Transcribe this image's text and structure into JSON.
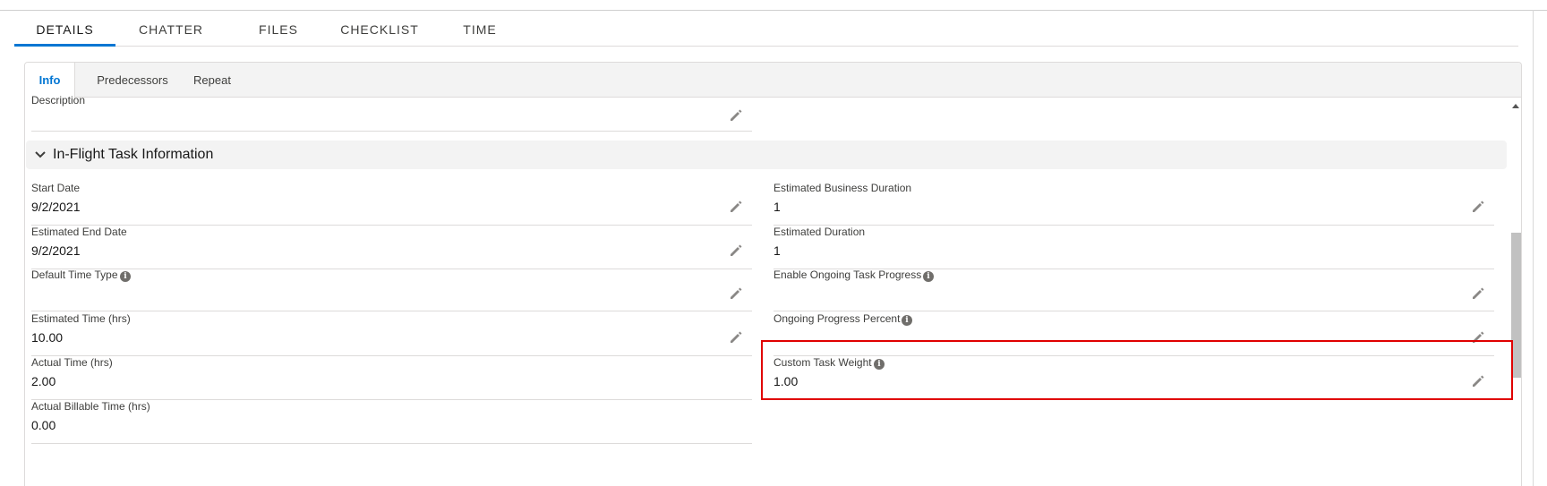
{
  "main_tabs": [
    "DETAILS",
    "CHATTER",
    "FILES",
    "CHECKLIST",
    "TIME"
  ],
  "sub_tabs": [
    "Info",
    "Predecessors",
    "Repeat"
  ],
  "description": {
    "label": "Description",
    "value": ""
  },
  "section": {
    "title": "In-Flight Task Information"
  },
  "left_fields": [
    {
      "label": "Start Date",
      "value": "9/2/2021",
      "info": false,
      "editable": true
    },
    {
      "label": "Estimated End Date",
      "value": "9/2/2021",
      "info": false,
      "editable": true
    },
    {
      "label": "Default Time Type",
      "value": "",
      "info": true,
      "editable": true
    },
    {
      "label": "Estimated Time (hrs)",
      "value": "10.00",
      "info": false,
      "editable": true
    },
    {
      "label": "Actual Time (hrs)",
      "value": "2.00",
      "info": false,
      "editable": false
    },
    {
      "label": "Actual Billable Time (hrs)",
      "value": "0.00",
      "info": false,
      "editable": false
    }
  ],
  "right_fields": [
    {
      "label": "Estimated Business Duration",
      "value": "1",
      "info": false,
      "editable": true
    },
    {
      "label": "Estimated Duration",
      "value": "1",
      "info": false,
      "editable": false
    },
    {
      "label": "Enable Ongoing Task Progress",
      "value": "",
      "info": true,
      "editable": true
    },
    {
      "label": "Ongoing Progress Percent",
      "value": "",
      "info": true,
      "editable": true
    },
    {
      "label": "Custom Task Weight",
      "value": "1.00",
      "info": true,
      "editable": true
    }
  ],
  "colors": {
    "accent": "#0176d3",
    "highlight": "#e00000"
  }
}
